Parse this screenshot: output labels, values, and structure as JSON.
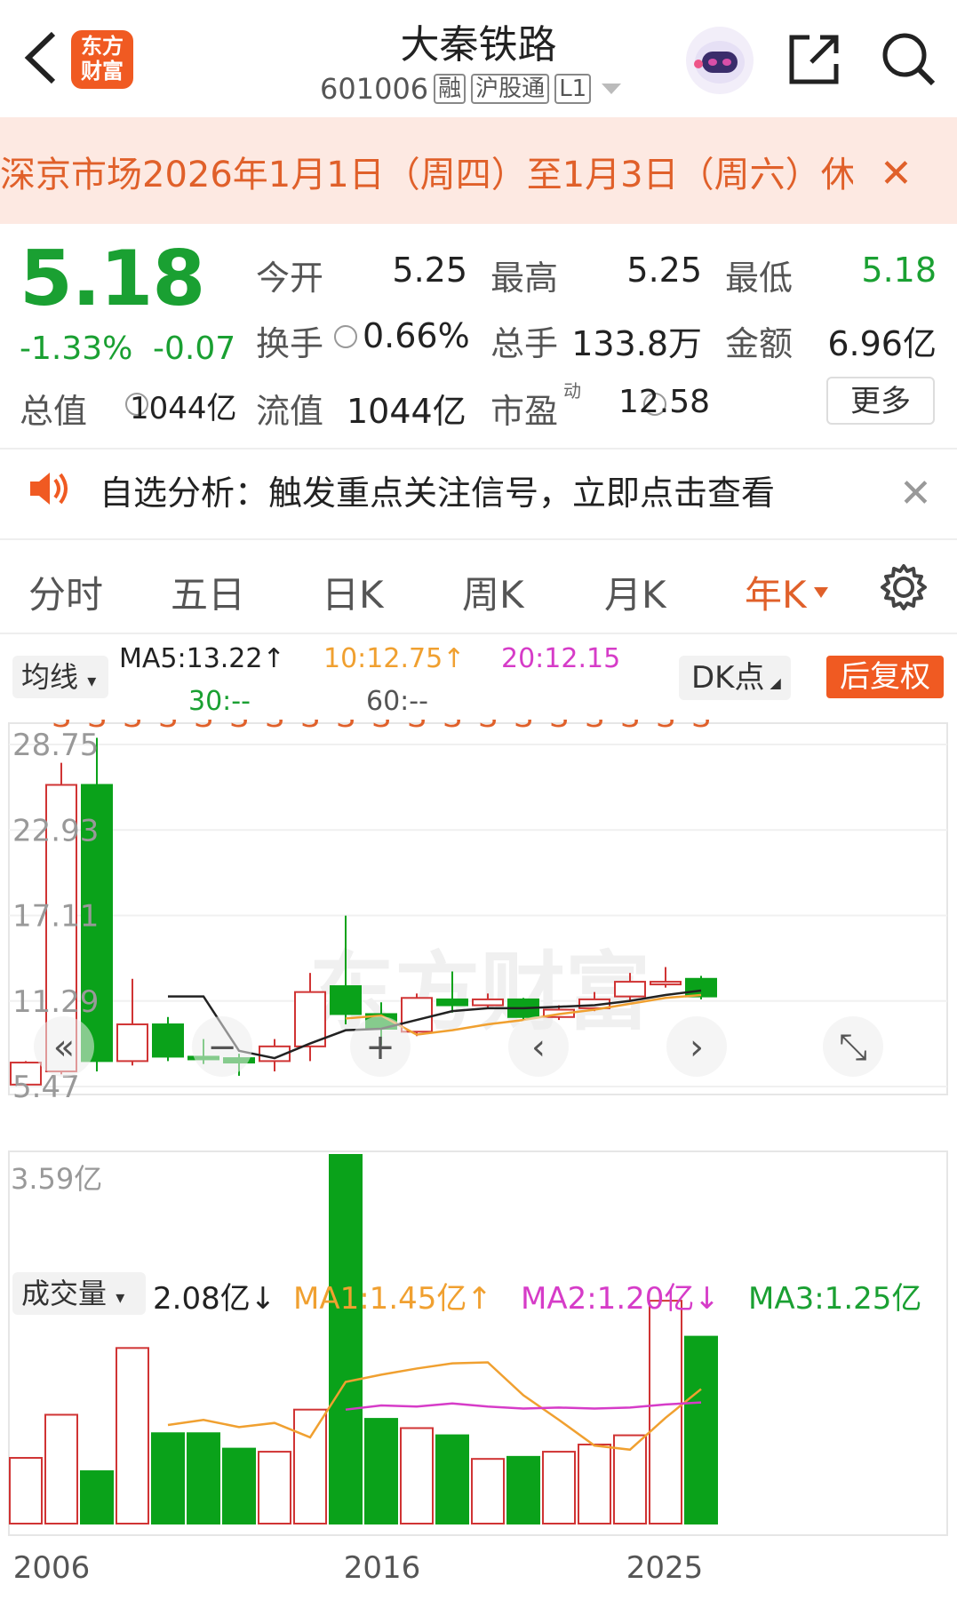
{
  "header": {
    "stock_name": "大秦铁路",
    "stock_code": "601006",
    "tags": [
      "融",
      "沪股通",
      "L1"
    ],
    "logo_text_1": "东方",
    "logo_text_2": "财富"
  },
  "notice": {
    "text": "深京市场2026年1月1日（周四）至1月3日（周六）休"
  },
  "quote": {
    "price": "5.18",
    "change_pct": "-1.33%",
    "change": "-0.07",
    "open_label": "今开",
    "open": "5.25",
    "high_label": "最高",
    "high": "5.25",
    "low_label": "最低",
    "low": "5.18",
    "turnover_label": "换手",
    "turnover": "0.66%",
    "volume_label": "总手",
    "volume": "133.8万",
    "amount_label": "金额",
    "amount": "6.96亿",
    "mktcap_label": "总值",
    "mktcap": "1044亿",
    "float_label": "流值",
    "float": "1044亿",
    "pe_label": "市盈",
    "pe_sup": "动",
    "pe": "12.58",
    "more": "更多"
  },
  "alert": {
    "text": "自选分析：触发重点关注信号，立即点击查看"
  },
  "tabs": [
    "分时",
    "五日",
    "日K",
    "周K",
    "月K",
    "年K"
  ],
  "ma": {
    "selector": "均线",
    "ma5": "MA5:13.22↑",
    "ma10": "10:12.75↑",
    "ma20": "20:12.15",
    "ma30": "30:--",
    "ma60": "60:--",
    "dk": "DK点",
    "adjust": "后复权"
  },
  "volume_bar": {
    "selector": "成交量",
    "value": "2.08亿↓",
    "ma1": "MA1:1.45亿↑",
    "ma2": "MA2:1.20亿↓",
    "ma3": "MA3:1.25亿"
  },
  "watermark": "东方财富",
  "colors": {
    "up": "#d03434",
    "down": "#0aa21a",
    "accent": "#f05a22",
    "ma5": "#222222",
    "ma10": "#f0a030",
    "ma20": "#d63cc8",
    "ma3": "#1aa032"
  },
  "chart_data": {
    "type": "candlestick",
    "y_ticks": [
      "28.75",
      "22.93",
      "17.11",
      "11.29",
      "5.47"
    ],
    "x_ticks": [
      "2006",
      "2016",
      "2025"
    ],
    "candles": [
      {
        "o": 5.6,
        "c": 7.1,
        "h": 7.2,
        "l": 5.6
      },
      {
        "o": 6.5,
        "c": 26.0,
        "h": 27.5,
        "l": 6.3
      },
      {
        "o": 26.0,
        "c": 7.2,
        "h": 29.2,
        "l": 6.5
      },
      {
        "o": 7.2,
        "c": 9.7,
        "h": 12.8,
        "l": 6.9
      },
      {
        "o": 9.7,
        "c": 7.5,
        "h": 10.2,
        "l": 7.2
      },
      {
        "o": 7.5,
        "c": 7.4,
        "h": 8.7,
        "l": 7.0
      },
      {
        "o": 7.4,
        "c": 7.1,
        "h": 7.7,
        "l": 6.2
      },
      {
        "o": 7.2,
        "c": 8.2,
        "h": 8.7,
        "l": 6.5
      },
      {
        "o": 8.2,
        "c": 11.9,
        "h": 13.2,
        "l": 7.2
      },
      {
        "o": 12.3,
        "c": 10.4,
        "h": 17.1,
        "l": 9.7
      },
      {
        "o": 10.4,
        "c": 9.4,
        "h": 11.2,
        "l": 8.3
      },
      {
        "o": 9.2,
        "c": 11.5,
        "h": 11.8,
        "l": 8.9
      },
      {
        "o": 11.4,
        "c": 11.0,
        "h": 13.3,
        "l": 10.5
      },
      {
        "o": 11.0,
        "c": 11.4,
        "h": 11.8,
        "l": 10.8
      },
      {
        "o": 11.4,
        "c": 10.2,
        "h": 11.5,
        "l": 10.0
      },
      {
        "o": 10.2,
        "c": 10.7,
        "h": 11.0,
        "l": 10.0
      },
      {
        "o": 10.8,
        "c": 11.4,
        "h": 11.9,
        "l": 10.6
      },
      {
        "o": 11.6,
        "c": 12.6,
        "h": 13.2,
        "l": 11.3
      },
      {
        "o": 12.5,
        "c": 12.6,
        "h": 13.6,
        "l": 12.2
      },
      {
        "o": 12.8,
        "c": 11.6,
        "h": 13.0,
        "l": 11.4
      }
    ],
    "ma5": [
      null,
      null,
      null,
      null,
      11.6,
      11.6,
      7.9,
      7.4,
      8.4,
      9.3,
      9.4,
      10.0,
      10.6,
      10.8,
      10.8,
      10.9,
      11.0,
      11.3,
      11.7,
      12.0
    ],
    "ma10": [
      null,
      null,
      null,
      null,
      null,
      null,
      null,
      null,
      null,
      10.1,
      10.3,
      9.0,
      9.3,
      9.7,
      10.0,
      10.4,
      10.7,
      11.1,
      11.5,
      11.7
    ],
    "volumes": [
      0.64,
      1.06,
      0.51,
      1.71,
      0.88,
      0.88,
      0.73,
      0.7,
      1.11,
      3.59,
      1.02,
      0.93,
      0.86,
      0.63,
      0.65,
      0.7,
      0.77,
      0.86,
      2.17,
      1.82
    ],
    "vol_ma1": [
      null,
      null,
      null,
      null,
      0.96,
      1.01,
      0.94,
      0.98,
      0.84,
      1.38,
      1.45,
      1.51,
      1.56,
      1.57,
      1.25,
      1.01,
      0.76,
      0.72,
      1.03,
      1.31
    ],
    "vol_ma2": [
      null,
      null,
      null,
      null,
      null,
      null,
      null,
      null,
      null,
      1.11,
      1.15,
      1.14,
      1.17,
      1.14,
      1.12,
      1.13,
      1.12,
      1.13,
      1.16,
      1.18
    ],
    "vol_ymax": "3.59亿"
  }
}
